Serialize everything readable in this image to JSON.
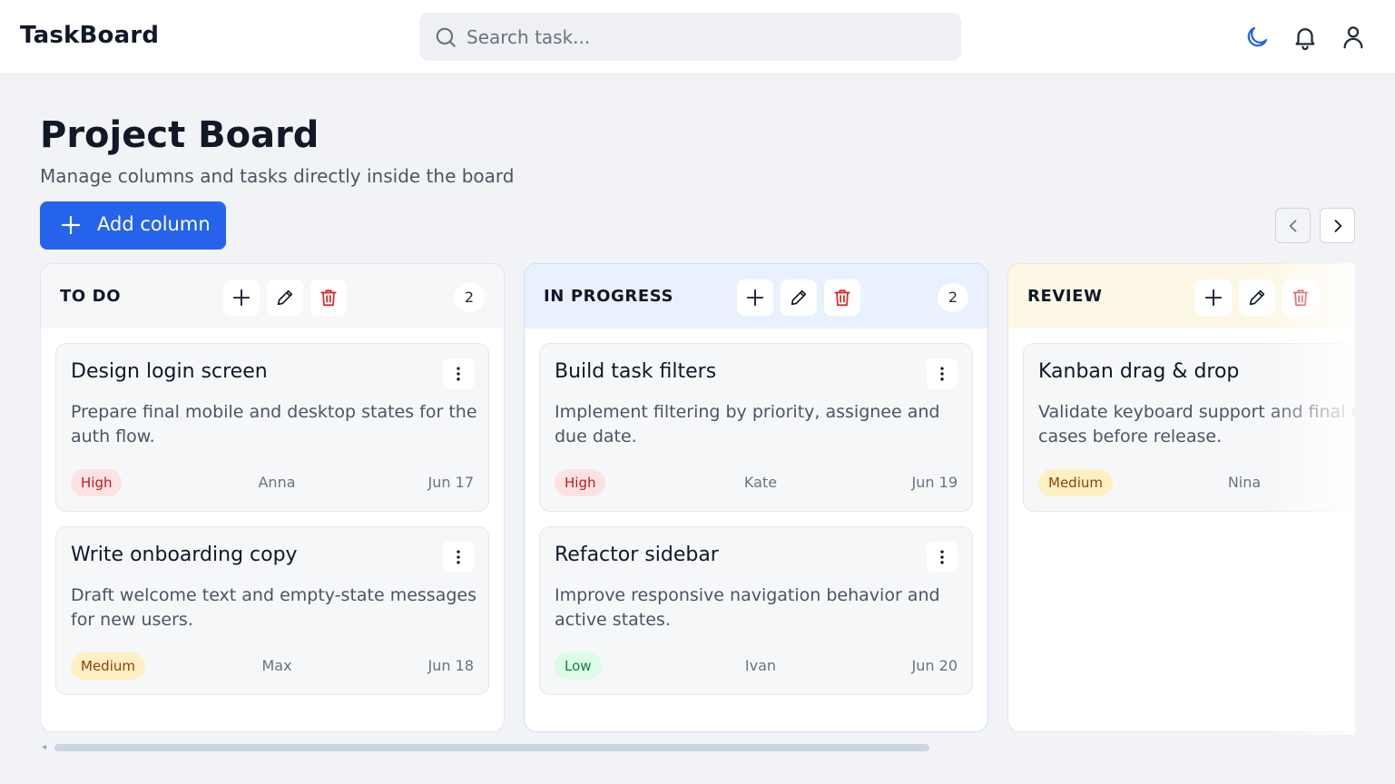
{
  "header": {
    "brand": "TaskBoard",
    "search_placeholder": "Search task...",
    "icons": [
      "moon-icon",
      "bell-icon",
      "user-icon"
    ],
    "accent": "#2563eb"
  },
  "page": {
    "title": "Project Board",
    "subtitle": "Manage columns and tasks directly inside the board",
    "add_column_label": "Add column"
  },
  "columns": [
    {
      "title": "TO DO",
      "count": "2",
      "header_color": "#f6f7f9",
      "cards": [
        {
          "title": "Design login screen",
          "description": "Prepare final mobile and desktop states for the auth flow.",
          "priority": "High",
          "assignee": "Anna",
          "due": "Jun 17"
        },
        {
          "title": "Write onboarding copy",
          "description": "Draft welcome text and empty-state messages for new users.",
          "priority": "Medium",
          "assignee": "Max",
          "due": "Jun 18"
        }
      ]
    },
    {
      "title": "IN PROGRESS",
      "count": "2",
      "header_color": "#e8f1fd",
      "cards": [
        {
          "title": "Build task filters",
          "description": "Implement filtering by priority, assignee and due date.",
          "priority": "High",
          "assignee": "Kate",
          "due": "Jun 19"
        },
        {
          "title": "Refactor sidebar",
          "description": "Improve responsive navigation behavior and active states.",
          "priority": "Low",
          "assignee": "Ivan",
          "due": "Jun 20"
        }
      ]
    },
    {
      "title": "REVIEW",
      "count": "",
      "header_color": "#fdf8e6",
      "cards": [
        {
          "title": "Kanban drag & drop",
          "description": "Validate keyboard support and final edge cases before release.",
          "priority": "Medium",
          "assignee": "Nina",
          "due": ""
        }
      ]
    }
  ],
  "colors": {
    "high": "#b91c1c",
    "medium": "#92400e",
    "low": "#15803d",
    "delete": "#dc2626"
  }
}
